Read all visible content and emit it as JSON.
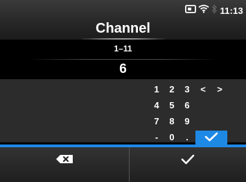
{
  "status_bar": {
    "time": "11:13",
    "icons": [
      "sim-card-icon",
      "wifi-icon",
      "bluetooth-icon"
    ]
  },
  "screen": {
    "title": "Channel",
    "range": "1–11",
    "value": "6"
  },
  "keypad": {
    "keys": [
      {
        "label": "1",
        "name": "key-1"
      },
      {
        "label": "2",
        "name": "key-2"
      },
      {
        "label": "3",
        "name": "key-3"
      },
      {
        "label": "<",
        "name": "key-cursor-left"
      },
      {
        "label": ">",
        "name": "key-cursor-right"
      },
      {
        "label": "4",
        "name": "key-4"
      },
      {
        "label": "5",
        "name": "key-5"
      },
      {
        "label": "6",
        "name": "key-6"
      },
      {
        "label": "",
        "name": "key-empty"
      },
      {
        "label": "",
        "name": "key-empty"
      },
      {
        "label": "7",
        "name": "key-7"
      },
      {
        "label": "8",
        "name": "key-8"
      },
      {
        "label": "9",
        "name": "key-9"
      },
      {
        "label": "",
        "name": "key-empty"
      },
      {
        "label": "",
        "name": "key-empty"
      },
      {
        "label": "-",
        "name": "key-minus"
      },
      {
        "label": "0",
        "name": "key-0"
      },
      {
        "label": ".",
        "name": "key-period"
      }
    ],
    "enter_icon": "checkmark-icon"
  },
  "bottom_bar": {
    "left_icon": "backspace-icon",
    "right_icon": "checkmark-icon"
  },
  "colors": {
    "accent": "#1e88e5",
    "background": "#000000",
    "panel": "#2c2c2c"
  }
}
